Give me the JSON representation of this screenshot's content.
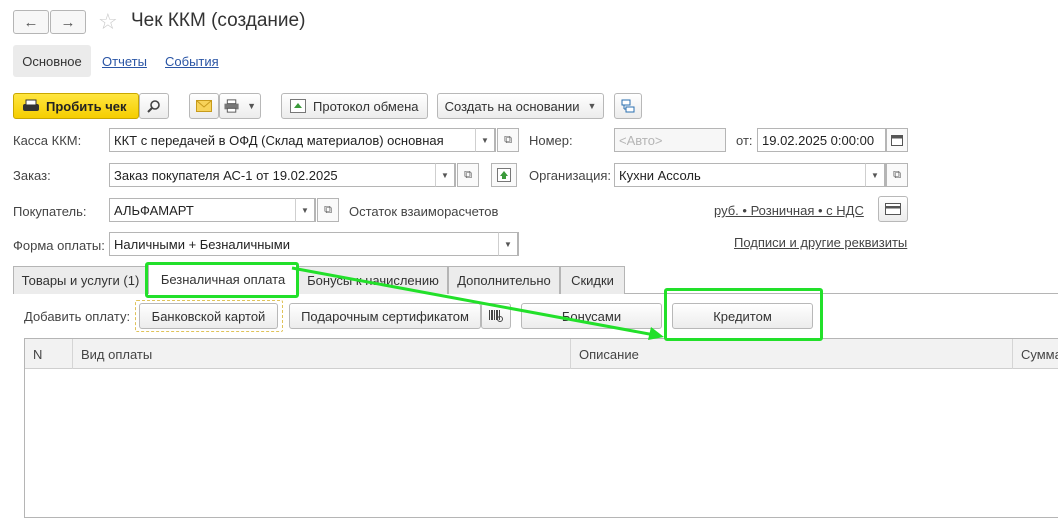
{
  "header": {
    "back_icon": "←",
    "forward_icon": "→",
    "star_icon": "☆",
    "title": "Чек ККМ (создание)"
  },
  "section_tabs": {
    "main": "Основное",
    "reports": "Отчеты",
    "events": "События"
  },
  "toolbar": {
    "print_receipt": "Пробить чек",
    "exchange_protocol": "Протокол обмена",
    "create_based_on": "Создать на основании"
  },
  "form": {
    "kassa_label": "Касса ККМ:",
    "kassa_value": "ККТ с передачей в ОФД (Склад материалов) основная",
    "number_label": "Номер:",
    "number_placeholder": "<Авто>",
    "date_from_label": "от:",
    "date_value": "19.02.2025  0:00:00",
    "order_label": "Заказ:",
    "order_value": "Заказ покупателя АС-1 от 19.02.2025",
    "org_label": "Организация:",
    "org_value": "Кухни Ассоль",
    "buyer_label": "Покупатель:",
    "buyer_value": "АЛЬФАМАРТ",
    "balance_label": "Остаток взаиморасчетов",
    "price_link": "руб. • Розничная • с НДС",
    "payment_label": "Форма оплаты:",
    "payment_value": "Наличными + Безналичными",
    "signatures_link": "Подписи и другие реквизиты"
  },
  "tabs": [
    {
      "label": "Товары и услуги (1)"
    },
    {
      "label": "Безналичная оплата"
    },
    {
      "label": "Бонусы к начислению"
    },
    {
      "label": "Дополнительно"
    },
    {
      "label": "Скидки"
    }
  ],
  "add_payment": {
    "label": "Добавить оплату:",
    "bank_card": "Банковской картой",
    "gift_cert": "Подарочным сертификатом",
    "bonuses": "Бонусами",
    "credit": "Кредитом"
  },
  "table": {
    "columns": [
      "N",
      "Вид оплаты",
      "Описание",
      "Сумма"
    ]
  },
  "colors": {
    "highlight": "#22e02a",
    "accent_yellow": "#f5ce00",
    "link": "#2a55a5"
  }
}
